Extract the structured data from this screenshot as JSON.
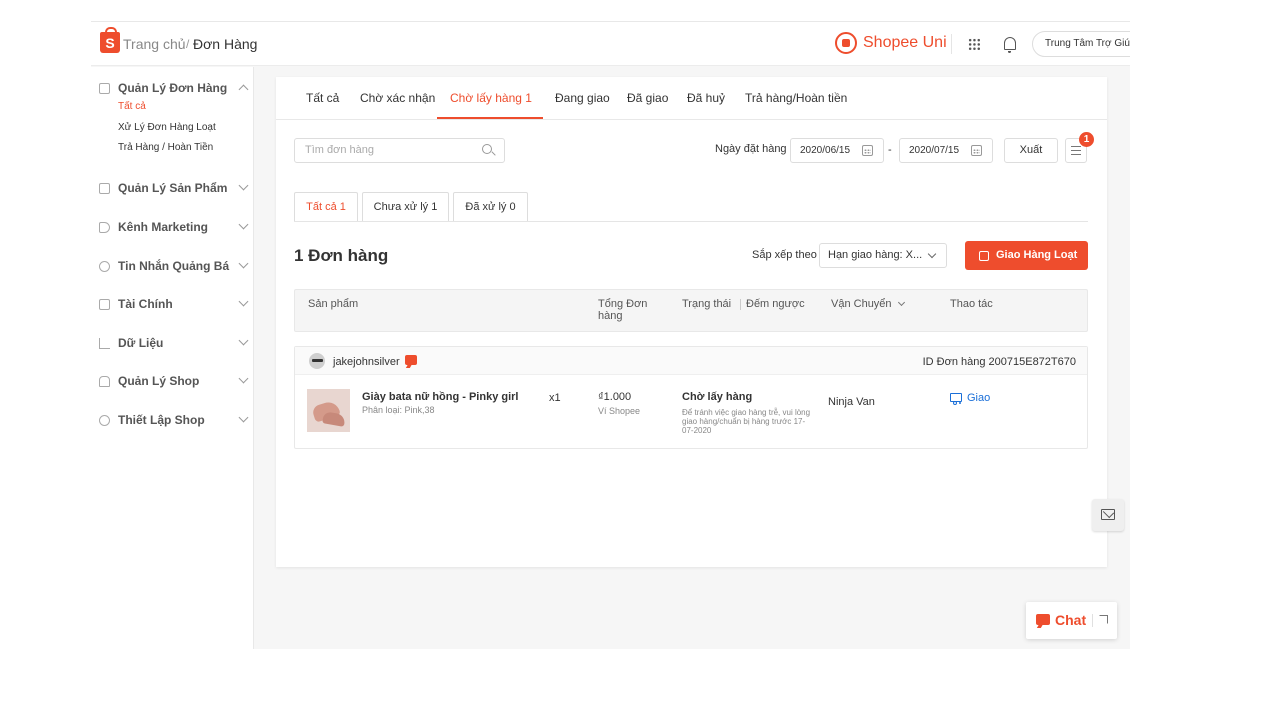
{
  "header": {
    "logo_letter": "S",
    "breadcrumb_home": "Trang chủ",
    "breadcrumb_sep": "/",
    "breadcrumb_page": "Đơn Hàng",
    "uni_label": "Shopee Uni",
    "help_label": "Trung Tâm Trợ Giúp"
  },
  "sidebar": {
    "items": [
      {
        "label": "Quản Lý Đơn Hàng",
        "icon": "clipboard-icon",
        "expanded": true
      },
      {
        "label": "Quản Lý Sản Phẩm",
        "icon": "box-icon"
      },
      {
        "label": "Kênh Marketing",
        "icon": "tag-icon"
      },
      {
        "label": "Tin Nhắn Quảng Bá",
        "icon": "users-icon"
      },
      {
        "label": "Tài Chính",
        "icon": "wallet-icon"
      },
      {
        "label": "Dữ Liệu",
        "icon": "chart-icon"
      },
      {
        "label": "Quản Lý Shop",
        "icon": "shop-icon"
      },
      {
        "label": "Thiết Lập Shop",
        "icon": "settings-icon"
      }
    ],
    "subitems": [
      "Tất cả",
      "Xử Lý Đơn Hàng Loạt",
      "Trả Hàng / Hoàn Tiền"
    ]
  },
  "tabs": [
    "Tất cả",
    "Chờ xác nhận",
    "Chờ lấy hàng 1",
    "Đang giao",
    "Đã giao",
    "Đã huỷ",
    "Trả hàng/Hoàn tiền"
  ],
  "filters": {
    "search_placeholder": "Tìm đơn hàng",
    "date_label": "Ngày đặt hàng",
    "date_from": "2020/06/15",
    "date_sep": "-",
    "date_to": "2020/07/15",
    "export_label": "Xuất",
    "notification_count": "1"
  },
  "subtabs": [
    "Tất cả 1",
    "Chưa xử lý 1",
    "Đã xử lý 0"
  ],
  "summary": {
    "order_count": "1 Đơn hàng",
    "sort_label": "Sắp xếp theo",
    "sort_value": "Hạn giao hàng: X...",
    "bulk_ship_label": "Giao Hàng Loạt"
  },
  "table_head": {
    "product": "Sản phẩm",
    "total": "Tổng Đơn hàng",
    "status": "Trạng thái",
    "countdown": "Đếm ngược",
    "shipping": "Vận Chuyển",
    "action": "Thao tác"
  },
  "order": {
    "buyer": "jakejohnsilver",
    "order_id": "ID Đơn hàng 200715E872T670",
    "product_name": "Giày bata nữ hồng - Pinky girl",
    "variant": "Phân loại: Pink,38",
    "quantity": "x1",
    "price": "₫1.000",
    "payment": "Ví Shopee",
    "status": "Chờ lấy hàng",
    "status_note": "Để tránh việc giao hàng trễ, vui lòng giao hàng/chuẩn bị hàng trước 17-07-2020",
    "carrier": "Ninja Van",
    "action": "Giao"
  },
  "chat": {
    "label": "Chat"
  },
  "colors": {
    "accent": "#ee4d2d",
    "link": "#1a6fd8"
  }
}
